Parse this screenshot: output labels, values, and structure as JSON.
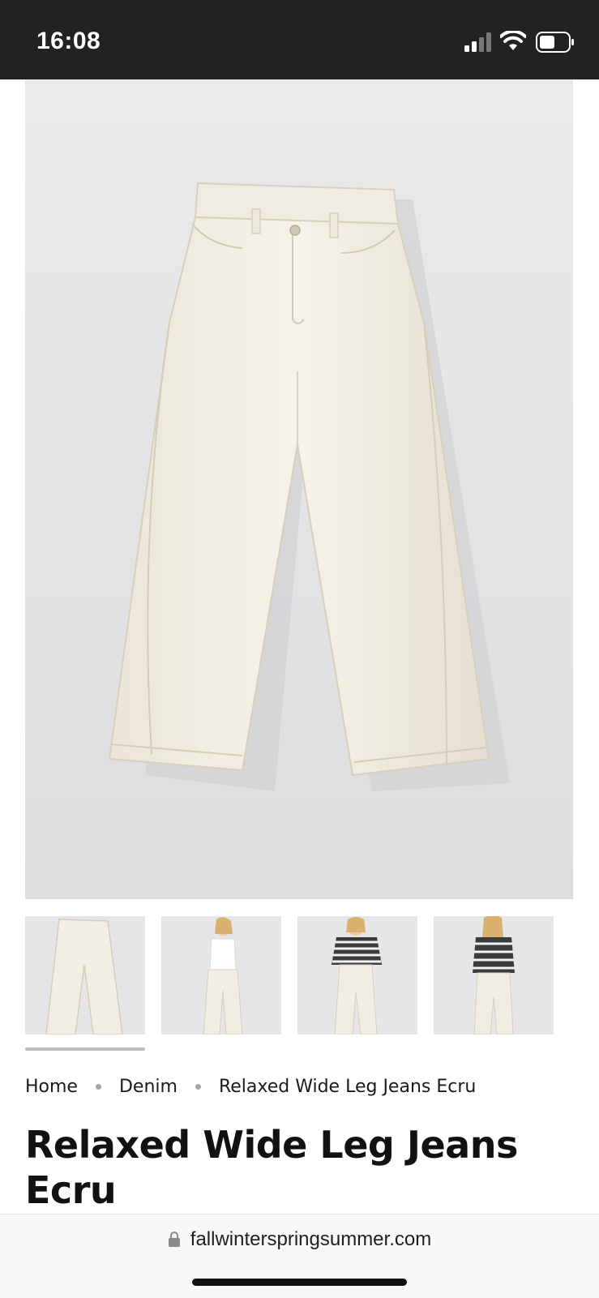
{
  "status_bar": {
    "time": "16:08",
    "icons": [
      "signal-icon",
      "wifi-icon",
      "battery-icon"
    ]
  },
  "product": {
    "main_image": "ecru-wide-leg-jeans-flat",
    "gallery": [
      {
        "name": "thumb-1",
        "subject": "jeans-flat"
      },
      {
        "name": "thumb-2",
        "subject": "model-white-tank-front"
      },
      {
        "name": "thumb-3",
        "subject": "model-striped-sweater-front"
      },
      {
        "name": "thumb-4",
        "subject": "model-striped-sweater-back"
      }
    ],
    "title": "Relaxed Wide Leg Jeans Ecru"
  },
  "breadcrumb": {
    "items": [
      "Home",
      "Denim",
      "Relaxed Wide Leg Jeans Ecru"
    ]
  },
  "browser": {
    "url": "fallwinterspringsummer.com"
  },
  "colors": {
    "status_bar": "#222222",
    "denim": "#f3efe5",
    "background": "#e6e6e8"
  }
}
